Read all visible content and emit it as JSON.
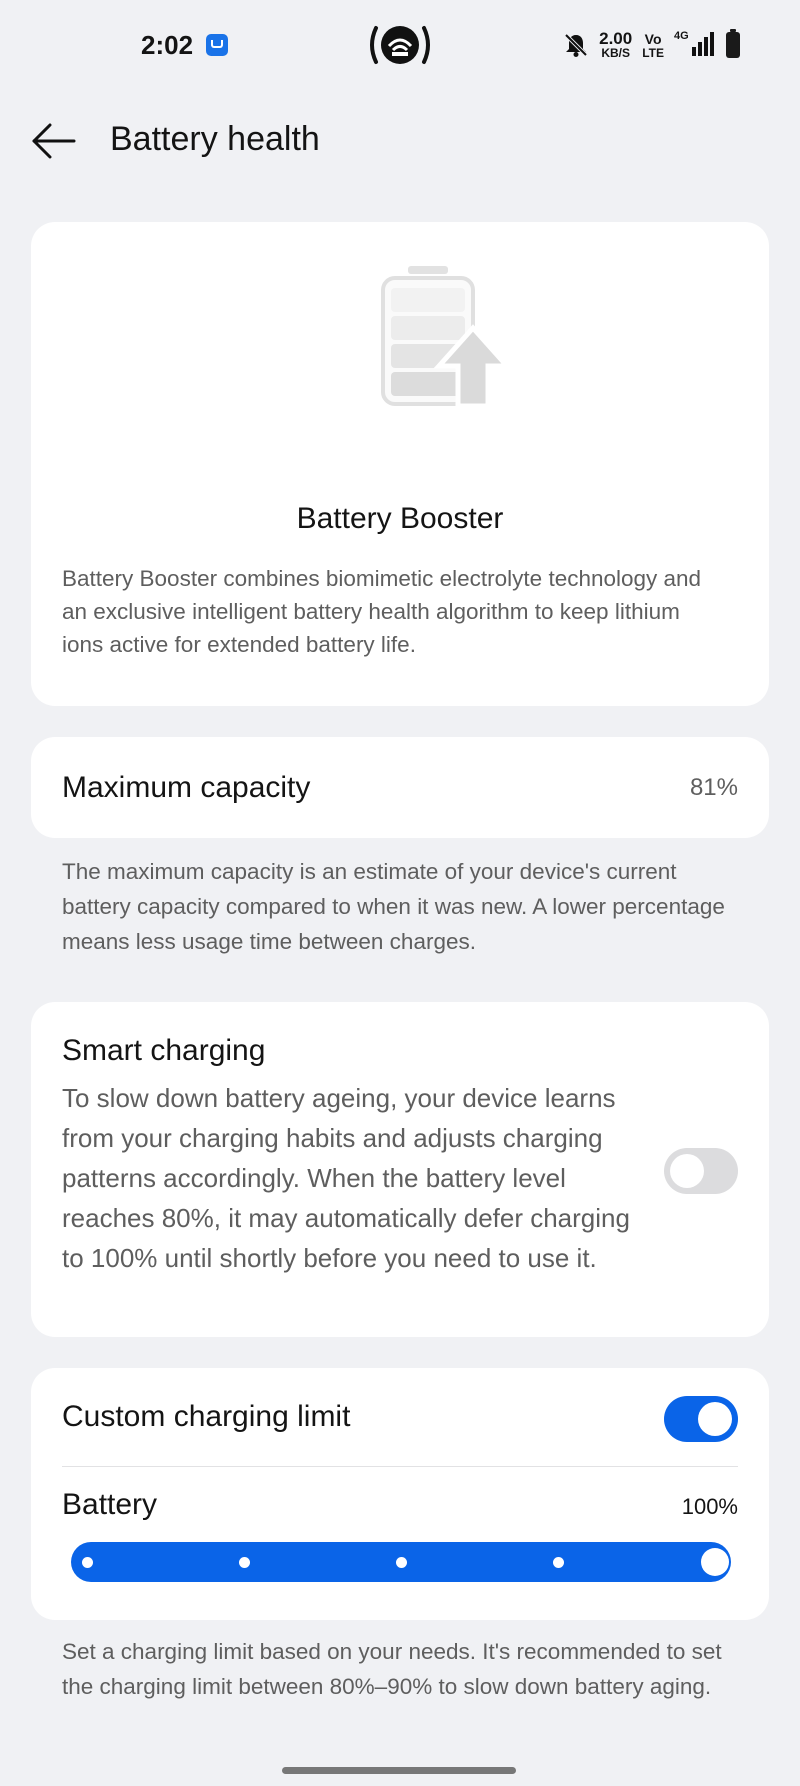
{
  "status_bar": {
    "time": "2:02",
    "network_speed": "2.00",
    "network_speed_unit": "KB/S",
    "volte_top": "Vo",
    "volte_bottom": "LTE",
    "network_type": "4G",
    "icons": [
      "app-notification-icon",
      "cast-icon",
      "bell-off-icon",
      "signal-icon",
      "battery-icon"
    ]
  },
  "header": {
    "title": "Battery health"
  },
  "booster": {
    "title": "Battery Booster",
    "description": "Battery Booster combines biomimetic electrolyte technology and an exclusive intelligent battery health algorithm to keep lithium ions active for extended battery life."
  },
  "capacity": {
    "label": "Maximum capacity",
    "value": "81%",
    "description": "The maximum capacity is an estimate of your device's current battery capacity compared to when it was new. A lower percentage means less usage time between charges."
  },
  "smart_charging": {
    "title": "Smart charging",
    "description": "To slow down battery ageing, your device learns from your charging habits and adjusts charging patterns accordingly. When the battery level reaches 80%, it may automatically defer charging to 100% until shortly before you need to use it.",
    "enabled": false
  },
  "custom_limit": {
    "title": "Custom charging limit",
    "enabled": true,
    "battery_label": "Battery",
    "battery_value": "100%",
    "slider_level": 1.0,
    "slider_steps": 5,
    "description": "Set a charging limit based on your needs. It's recommended to set the charging limit between 80%–90% to slow down battery aging."
  },
  "colors": {
    "accent": "#0a64e8",
    "background": "#f0f1f4",
    "card": "#ffffff",
    "secondary_text": "#5e5e5e"
  }
}
